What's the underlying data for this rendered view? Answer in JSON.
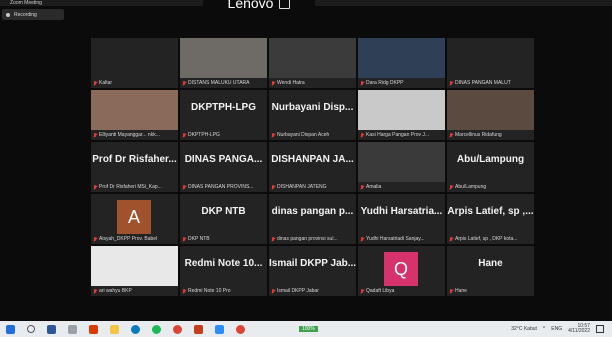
{
  "window": {
    "title": "Zoom Meeting"
  },
  "laptop_brand": "Lenovo",
  "recording": {
    "label": "Recording"
  },
  "tiles": [
    {
      "label": "Kaltar",
      "big": "",
      "kind": "blank"
    },
    {
      "label": "DISTANS MALUKU UTARA",
      "big": "",
      "kind": "video",
      "color": "#6e6a66"
    },
    {
      "label": "Wendi Hatra",
      "big": "",
      "kind": "video",
      "color": "#3b3b3b"
    },
    {
      "label": "Dara Ridg DKPP",
      "big": "",
      "kind": "video",
      "color": "#2f3f55"
    },
    {
      "label": "DINAS PANGAN MALUT",
      "big": "",
      "kind": "blank"
    },
    {
      "label": "Elliyanti Mayanggar... nkk...",
      "big": "",
      "kind": "video",
      "color": "#8a6a5a"
    },
    {
      "label": "DKPTPH-LPG",
      "big": "DKPTPH-LPG",
      "kind": "name"
    },
    {
      "label": "Nurbayani Dispan Aceh",
      "big": "Nurbayani Disp...",
      "kind": "name"
    },
    {
      "label": "Kasi Harga Pangan Prov J...",
      "big": "",
      "kind": "video",
      "color": "#c9c9c9"
    },
    {
      "label": "Marcellinus Ridafung",
      "big": "",
      "kind": "video",
      "color": "#5a4a40"
    },
    {
      "label": "Prof Dr Risfaheri MSi_Kap...",
      "big": "Prof Dr Risfaher...",
      "kind": "name"
    },
    {
      "label": "DINAS PANGAN PROVINS...",
      "big": "DINAS PANGA...",
      "kind": "name"
    },
    {
      "label": "DISHANPAN JATENG",
      "big": "DISHANPAN JA...",
      "kind": "name"
    },
    {
      "label": "Amalia",
      "big": "",
      "kind": "video",
      "color": "#3a3a3a"
    },
    {
      "label": "Abu/Lampung",
      "big": "Abu/Lampung",
      "kind": "name"
    },
    {
      "label": "Aisyah_DKPP Prov. Babel",
      "big": "",
      "kind": "avatar",
      "letter": "A",
      "color": "#a0522d"
    },
    {
      "label": "DKP NTB",
      "big": "DKP NTB",
      "kind": "name"
    },
    {
      "label": "dinas pangan provinsi sul...",
      "big": "dinas pangan p...",
      "kind": "name"
    },
    {
      "label": "Yudhi Harsatriadi Sanjay...",
      "big": "Yudhi Harsatria...",
      "kind": "name"
    },
    {
      "label": "Arpis Latief, sp , DKP kota...",
      "big": "Arpis Latief, sp ,...",
      "kind": "name"
    },
    {
      "label": "ari wahyu BKP",
      "big": "",
      "kind": "video",
      "color": "#e8e8e8"
    },
    {
      "label": "Redmi Note 10 Pro",
      "big": "Redmi Note 10...",
      "kind": "name"
    },
    {
      "label": "Ismail DKPP Jabar",
      "big": "Ismail DKPP Jab...",
      "kind": "name"
    },
    {
      "label": "Qadaft Libya",
      "big": "",
      "kind": "avatar",
      "letter": "Q",
      "color": "#d6336c"
    },
    {
      "label": "Hane",
      "big": "Hane",
      "kind": "name"
    }
  ],
  "taskbar": {
    "weather": "32°C Kabut",
    "language": "ENG",
    "time": "10:57",
    "date": "4/11/2022",
    "battery": "100%"
  },
  "icons": [
    "windows-icon",
    "search-icon",
    "task-view-icon",
    "settings-icon",
    "office-icon",
    "explorer-icon",
    "edge-icon",
    "spotify-icon",
    "chrome-icon",
    "powerpoint-icon",
    "zoom-icon",
    "chrome-icon"
  ]
}
